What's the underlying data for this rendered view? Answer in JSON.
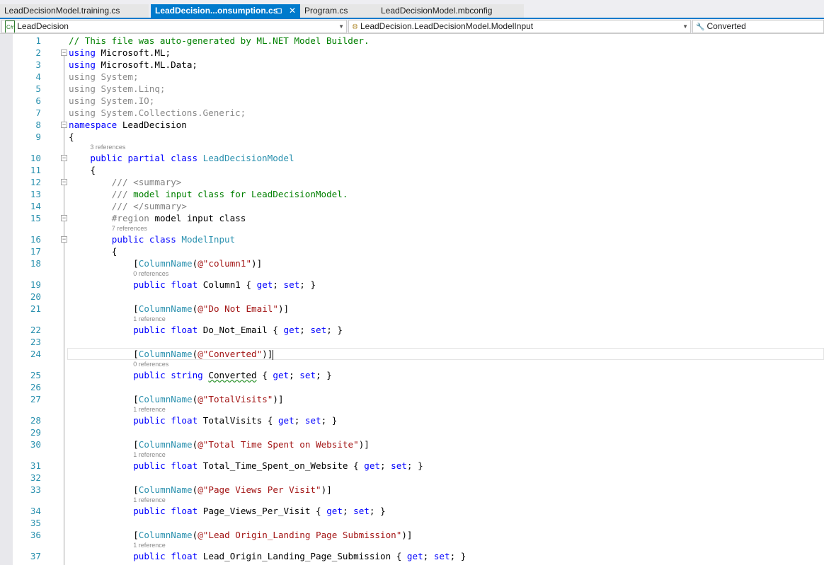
{
  "tabs": [
    {
      "label": "LeadDecisionModel.training.cs",
      "active": false
    },
    {
      "label": "LeadDecision...onsumption.cs",
      "active": true,
      "pin": "⊐",
      "close": "✕"
    },
    {
      "label": "Program.cs",
      "active": false
    },
    {
      "label": "LeadDecisionModel.mbconfig",
      "active": false
    }
  ],
  "navbar": {
    "project": "LeadDecision",
    "project_icon": "C#",
    "type": "LeadDecision.LeadDecisionModel.ModelInput",
    "member": "Converted"
  },
  "lines": [
    {
      "n": "1",
      "i": 0,
      "seg": [
        [
          "c",
          "// This file was auto-generated by ML.NET Model Builder."
        ]
      ]
    },
    {
      "n": "2",
      "i": 0,
      "fold": true,
      "seg": [
        [
          "k",
          "using"
        ],
        [
          "",
          "Microsoft.ML;"
        ]
      ]
    },
    {
      "n": "3",
      "i": 0,
      "seg": [
        [
          "k",
          "using"
        ],
        [
          "",
          "Microsoft.ML.Data;"
        ]
      ]
    },
    {
      "n": "4",
      "i": 0,
      "seg": [
        [
          "u",
          "using System;"
        ]
      ]
    },
    {
      "n": "5",
      "i": 0,
      "seg": [
        [
          "u",
          "using System.Linq;"
        ]
      ]
    },
    {
      "n": "6",
      "i": 0,
      "seg": [
        [
          "u",
          "using System.IO;"
        ]
      ]
    },
    {
      "n": "7",
      "i": 0,
      "seg": [
        [
          "u",
          "using System.Collections.Generic;"
        ]
      ]
    },
    {
      "n": "8",
      "i": 0,
      "fold": true,
      "seg": [
        [
          "k",
          "namespace"
        ],
        [
          "",
          "LeadDecision"
        ]
      ]
    },
    {
      "n": "9",
      "i": 0,
      "seg": [
        [
          "",
          "{"
        ]
      ]
    },
    {
      "lens": "3 references",
      "i": 1
    },
    {
      "n": "10",
      "i": 1,
      "fold": true,
      "seg": [
        [
          "k",
          "public partial class"
        ],
        [
          "t",
          "LeadDecisionModel"
        ]
      ]
    },
    {
      "n": "11",
      "i": 1,
      "seg": [
        [
          "",
          "{"
        ]
      ]
    },
    {
      "n": "12",
      "i": 2,
      "fold": true,
      "seg": [
        [
          "g",
          "/// <summary>"
        ]
      ]
    },
    {
      "n": "13",
      "i": 2,
      "seg": [
        [
          "g",
          "///"
        ],
        [
          "c",
          "model input class for LeadDecisionModel."
        ]
      ]
    },
    {
      "n": "14",
      "i": 2,
      "seg": [
        [
          "g",
          "/// </summary>"
        ]
      ]
    },
    {
      "n": "15",
      "i": 2,
      "fold": true,
      "seg": [
        [
          "g",
          "#region"
        ],
        [
          "",
          "model input class"
        ]
      ]
    },
    {
      "lens": "7 references",
      "i": 2
    },
    {
      "n": "16",
      "i": 2,
      "fold": true,
      "seg": [
        [
          "k",
          "public class"
        ],
        [
          "t",
          "ModelInput"
        ]
      ]
    },
    {
      "n": "17",
      "i": 2,
      "seg": [
        [
          "",
          "{"
        ]
      ]
    },
    {
      "n": "18",
      "i": 3,
      "attr": "column1"
    },
    {
      "lens": "0 references",
      "i": 3
    },
    {
      "n": "19",
      "i": 3,
      "prop": [
        "float",
        "Column1"
      ]
    },
    {
      "n": "20",
      "i": 0,
      "seg": []
    },
    {
      "n": "21",
      "i": 3,
      "attr": "Do Not Email"
    },
    {
      "lens": "1 reference",
      "i": 3
    },
    {
      "n": "22",
      "i": 3,
      "prop": [
        "float",
        "Do_Not_Email"
      ]
    },
    {
      "n": "23",
      "i": 0,
      "seg": []
    },
    {
      "n": "24",
      "i": 3,
      "attr": "Converted",
      "current": true
    },
    {
      "lens": "0 references",
      "i": 3
    },
    {
      "n": "25",
      "i": 3,
      "prop": [
        "string",
        "Converted"
      ],
      "squiggle": true
    },
    {
      "n": "26",
      "i": 0,
      "seg": []
    },
    {
      "n": "27",
      "i": 3,
      "attr": "TotalVisits"
    },
    {
      "lens": "1 reference",
      "i": 3
    },
    {
      "n": "28",
      "i": 3,
      "prop": [
        "float",
        "TotalVisits"
      ]
    },
    {
      "n": "29",
      "i": 0,
      "seg": []
    },
    {
      "n": "30",
      "i": 3,
      "attr": "Total Time Spent on Website"
    },
    {
      "lens": "1 reference",
      "i": 3
    },
    {
      "n": "31",
      "i": 3,
      "prop": [
        "float",
        "Total_Time_Spent_on_Website"
      ]
    },
    {
      "n": "32",
      "i": 0,
      "seg": []
    },
    {
      "n": "33",
      "i": 3,
      "attr": "Page Views Per Visit"
    },
    {
      "lens": "1 reference",
      "i": 3
    },
    {
      "n": "34",
      "i": 3,
      "prop": [
        "float",
        "Page_Views_Per_Visit"
      ]
    },
    {
      "n": "35",
      "i": 0,
      "seg": []
    },
    {
      "n": "36",
      "i": 3,
      "attr": "Lead Origin_Landing Page Submission"
    },
    {
      "lens": "1 reference",
      "i": 3
    },
    {
      "n": "37",
      "i": 3,
      "prop": [
        "float",
        "Lead_Origin_Landing_Page_Submission"
      ]
    }
  ],
  "colors": {
    "accent": "#007acc",
    "keyword": "#0000ff",
    "type": "#2b91af",
    "string": "#a31515",
    "comment": "#008000"
  }
}
